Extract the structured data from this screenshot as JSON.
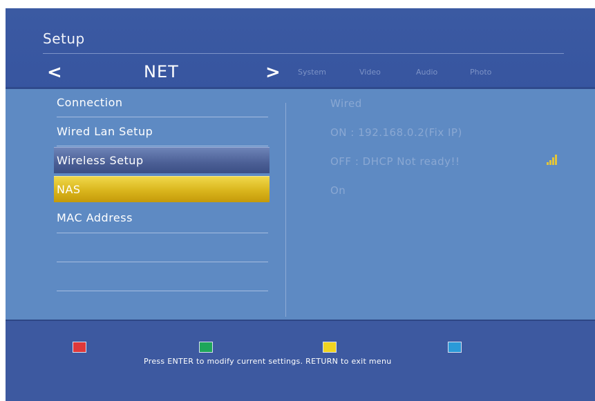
{
  "header": {
    "title": "Setup",
    "nav_prev_glyph": "<",
    "nav_next_glyph": ">",
    "current_tab": "NET",
    "other_tabs": [
      "System",
      "Video",
      "Audio",
      "Photo"
    ]
  },
  "menu": {
    "items": [
      {
        "label": "Connection",
        "value": "Wired"
      },
      {
        "label": "Wired Lan Setup",
        "value": "ON : 192.168.0.2(Fix IP)"
      },
      {
        "label": "Wireless Setup",
        "value": "OFF : DHCP Not ready!!"
      },
      {
        "label": "NAS",
        "value": "On"
      },
      {
        "label": "MAC Address",
        "value": ""
      }
    ],
    "selected_index": 2,
    "focused_index": 3
  },
  "icons": {
    "signal": "wifi-signal-icon"
  },
  "footer": {
    "keys": [
      {
        "name": "red-key",
        "color": "#e0383a"
      },
      {
        "name": "green-key",
        "color": "#1ea65a"
      },
      {
        "name": "yellow-key",
        "color": "#f0d320"
      },
      {
        "name": "blue-key",
        "color": "#2a9ad8"
      }
    ],
    "hint": "Press ENTER to modify current settings. RETURN to exit menu"
  },
  "colors": {
    "background": "#3a5aa0",
    "panel": "#5e8ac3",
    "focus": "#d9b51c",
    "signal": "#e2c53a"
  }
}
